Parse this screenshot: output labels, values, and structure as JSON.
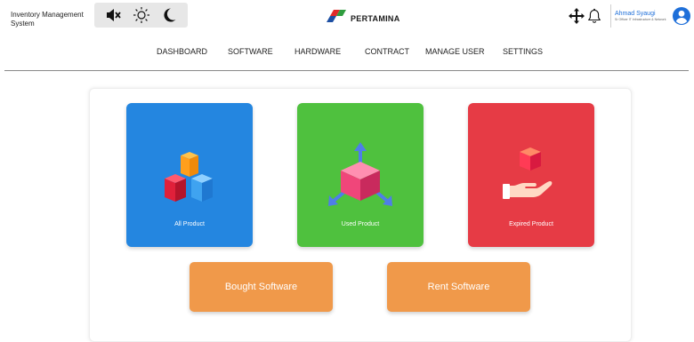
{
  "header": {
    "app_title": "Inventory Management System",
    "brand_name": "PERTAMINA",
    "toggles": [
      "mute-icon",
      "sun-icon",
      "moon-icon"
    ],
    "actions": [
      "move-icon",
      "bell-icon"
    ],
    "user_name": "Ahmad Syaugi",
    "user_role": "Sr Officer IT Infrastructure & Network",
    "avatar_icon": "user-circle-icon"
  },
  "nav": {
    "items": [
      "DASHBOARD",
      "SOFTWARE",
      "HARDWARE",
      "CONTRACT",
      "MANAGE USER",
      "SETTINGS"
    ]
  },
  "dashboard": {
    "tiles": [
      {
        "label": "All Product",
        "color": "#2486e0",
        "icon": "cubes-icon"
      },
      {
        "label": "Used Product",
        "color": "#4fc13e",
        "icon": "cube-arrows-icon"
      },
      {
        "label": "Expired Product",
        "color": "#e63b45",
        "icon": "hand-cube-icon"
      }
    ],
    "buttons": [
      {
        "label": "Bought Software",
        "color": "#f0994a"
      },
      {
        "label": "Rent Software",
        "color": "#f0994a"
      }
    ]
  }
}
